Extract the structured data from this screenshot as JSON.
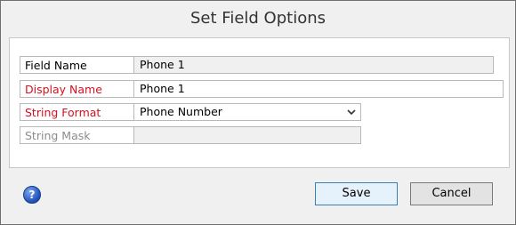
{
  "dialog": {
    "title": "Set Field Options"
  },
  "fields": {
    "field_name": {
      "label": "Field Name",
      "value": "Phone 1"
    },
    "display_name": {
      "label": "Display Name",
      "value": "Phone 1"
    },
    "string_format": {
      "label": "String Format",
      "value": "Phone Number"
    },
    "string_mask": {
      "label": "String Mask",
      "value": ""
    }
  },
  "footer": {
    "help_icon": "help-icon",
    "help_glyph": "?",
    "save_label": "Save",
    "cancel_label": "Cancel"
  },
  "colors": {
    "required_label": "#d4111f",
    "disabled_label": "#8c8c8c",
    "accent": "#3c7fb1"
  }
}
